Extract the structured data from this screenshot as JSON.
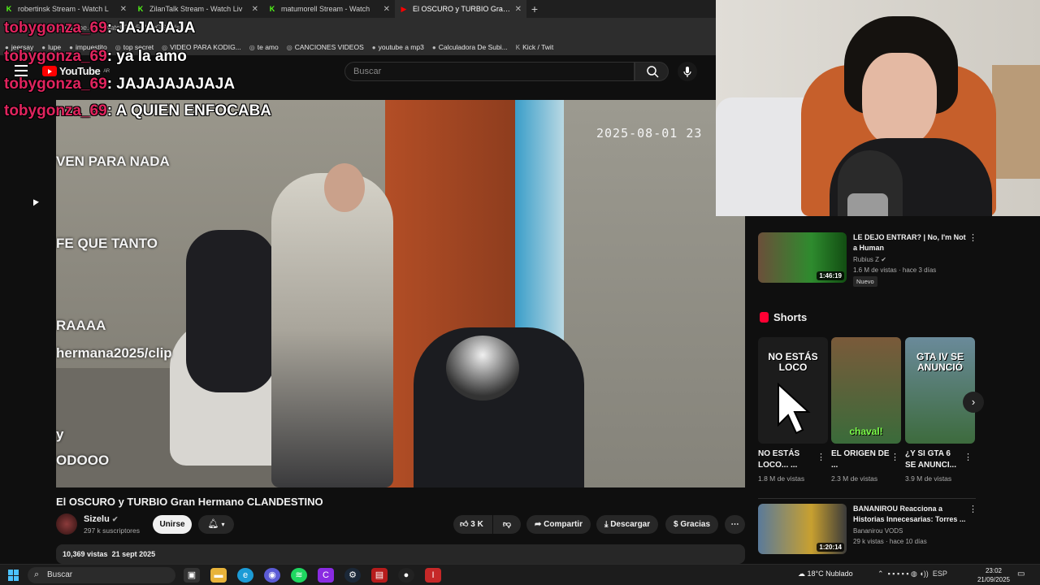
{
  "browser": {
    "tabs": [
      {
        "label": "robertinsk Stream - Watch L",
        "favicon": "kick-icon",
        "color": "#53fc18"
      },
      {
        "label": "ZilanTalk Stream - Watch Liv",
        "favicon": "kick-icon",
        "color": "#53fc18"
      },
      {
        "label": "matumorell Stream - Watch",
        "favicon": "kick-icon",
        "color": "#53fc18"
      },
      {
        "label": "El OSCURO y TURBIO Gran H",
        "favicon": "youtube-icon",
        "color": "#ff0000",
        "active": true
      }
    ],
    "address": "ww.youtube.com/watch?v=5CWvGSEVs",
    "bookmarks": [
      "jeersay",
      "lupe",
      "impuestito",
      "top secret",
      "VIDEO PARA KODIG...",
      "te amo",
      "CANCIONES VIDEOS",
      "youtube a mp3",
      "Calculadora De Subi...",
      "Kick / Twit"
    ]
  },
  "youtube": {
    "logo_text": "YouTube",
    "logo_region": "AR",
    "search_placeholder": "Buscar"
  },
  "chat_overlay": [
    {
      "user": "tobygonza_69",
      "message": ": JAJAJAJA"
    },
    {
      "user": "tobygonza_69",
      "message": ": ya la amo"
    },
    {
      "user": "tobygonza_69",
      "message": ": JAJAJAJAJAJA"
    },
    {
      "user": "tobygonza_69",
      "message": ": A QUIEN ENFOCABA"
    }
  ],
  "video": {
    "timestamp": "2025-08-01 23",
    "overlay_lines": [
      "VEN PARA NADA",
      "FE QUE TANTO",
      "RAAAA",
      "hermana2025/clip",
      "y",
      "ODOOO"
    ],
    "title": "El OSCURO y TURBIO Gran Hermano CLANDESTINO",
    "channel": "Sizelu",
    "subscribers": "297 k suscriptores",
    "join_label": "Unirse",
    "likes": "3 K",
    "share_label": "Compartir",
    "download_label": "Descargar",
    "thanks_label": "Gracias",
    "views": "10,369 vistas",
    "date": "21 sept 2025"
  },
  "sidebar": {
    "related": [
      {
        "title": "LE DEJO ENTRAR? | No, I'm Not a Human",
        "channel": "Rubius Z",
        "meta": "1.6 M de vistas · hace 3 días",
        "duration": "1:46:19",
        "badge": "Nuevo"
      },
      {
        "title": "BANANIROU Reacciona a Historias Innecesarias: Torres ...",
        "channel": "Bananirou VODS",
        "meta": "29 k vistas · hace 10 días",
        "duration": "1:20:14"
      }
    ],
    "shorts_heading": "Shorts",
    "shorts": [
      {
        "thumb_text": "NO ESTÁS LOCO",
        "title": "NO ESTÁS LOCO... ...",
        "views": "1.8 M de vistas"
      },
      {
        "thumb_text": "chaval!",
        "title": "EL ORIGEN DE ...",
        "views": "2.3 M de vistas"
      },
      {
        "thumb_text": "GTA IV SE ANUNCIÓ",
        "title": "¿Y SI GTA 6 SE ANUNCI...",
        "views": "3.9 M de vistas"
      }
    ]
  },
  "taskbar": {
    "search_label": "Buscar",
    "weather": "18°C  Nublado",
    "lang": "ESP",
    "time": "23:02",
    "date": "21/09/2025"
  }
}
